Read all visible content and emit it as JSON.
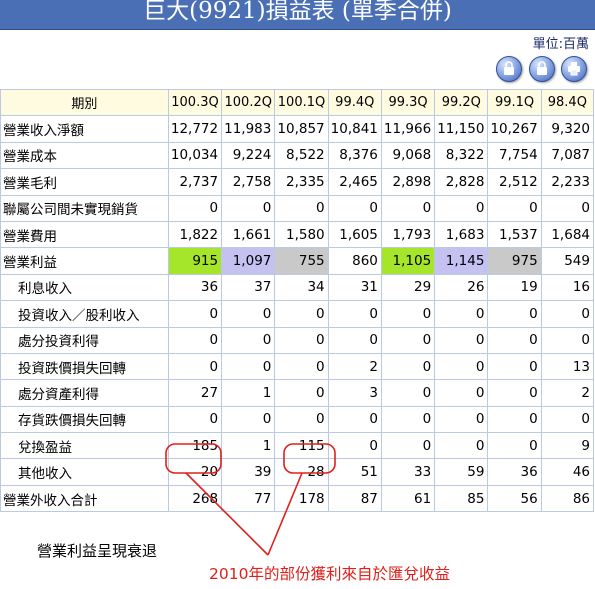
{
  "header": {
    "title": "巨大(9921)損益表 (單季合併)",
    "unit": "單位:百萬"
  },
  "toolbar": {
    "buttons": [
      {
        "icon": "lock-icon"
      },
      {
        "icon": "lock-icon"
      },
      {
        "icon": "printer-icon"
      }
    ]
  },
  "table": {
    "period_header": "期別",
    "periods": [
      "100.3Q",
      "100.2Q",
      "100.1Q",
      "99.4Q",
      "99.3Q",
      "99.2Q",
      "99.1Q",
      "98.4Q"
    ],
    "rows": [
      {
        "label": "營業收入淨額",
        "indent": false,
        "values": [
          "12,772",
          "11,983",
          "10,857",
          "10,841",
          "11,966",
          "11,150",
          "10,267",
          "9,320"
        ]
      },
      {
        "label": "營業成本",
        "indent": false,
        "values": [
          "10,034",
          "9,224",
          "8,522",
          "8,376",
          "9,068",
          "8,322",
          "7,754",
          "7,087"
        ]
      },
      {
        "label": "營業毛利",
        "indent": false,
        "values": [
          "2,737",
          "2,758",
          "2,335",
          "2,465",
          "2,898",
          "2,828",
          "2,512",
          "2,233"
        ]
      },
      {
        "label": "聯屬公司間未實現銷貨",
        "indent": false,
        "values": [
          "0",
          "0",
          "0",
          "0",
          "0",
          "0",
          "0",
          "0"
        ]
      },
      {
        "label": "營業費用",
        "indent": false,
        "values": [
          "1,822",
          "1,661",
          "1,580",
          "1,605",
          "1,793",
          "1,683",
          "1,537",
          "1,684"
        ]
      },
      {
        "label": "營業利益",
        "indent": false,
        "values": [
          "915",
          "1,097",
          "755",
          "860",
          "1,105",
          "1,145",
          "975",
          "549"
        ],
        "highlights": [
          "green",
          "purple",
          "gray",
          "",
          "green",
          "purple",
          "gray",
          ""
        ]
      },
      {
        "label": "利息收入",
        "indent": true,
        "values": [
          "36",
          "37",
          "34",
          "31",
          "29",
          "26",
          "19",
          "16"
        ]
      },
      {
        "label": "投資收入／股利收入",
        "indent": true,
        "values": [
          "0",
          "0",
          "0",
          "0",
          "0",
          "0",
          "0",
          "0"
        ]
      },
      {
        "label": "處分投資利得",
        "indent": true,
        "values": [
          "0",
          "0",
          "0",
          "0",
          "0",
          "0",
          "0",
          "0"
        ]
      },
      {
        "label": "投資跌價損失回轉",
        "indent": true,
        "values": [
          "0",
          "0",
          "0",
          "2",
          "0",
          "0",
          "0",
          "13"
        ]
      },
      {
        "label": "處分資產利得",
        "indent": true,
        "values": [
          "27",
          "1",
          "0",
          "3",
          "0",
          "0",
          "0",
          "2"
        ]
      },
      {
        "label": "存貨跌價損失回轉",
        "indent": true,
        "values": [
          "0",
          "0",
          "0",
          "0",
          "0",
          "0",
          "0",
          "0"
        ]
      },
      {
        "label": "兌換盈益",
        "indent": true,
        "values": [
          "185",
          "1",
          "115",
          "0",
          "0",
          "0",
          "0",
          "9"
        ]
      },
      {
        "label": "其他收入",
        "indent": true,
        "values": [
          "20",
          "39",
          "28",
          "51",
          "33",
          "59",
          "36",
          "46"
        ]
      },
      {
        "label": "營業外收入合計",
        "indent": false,
        "values": [
          "268",
          "77",
          "178",
          "87",
          "61",
          "85",
          "56",
          "86"
        ]
      }
    ]
  },
  "annotations": {
    "note_decline": "營業利益呈現衰退",
    "note_fx": "2010年的部份獲利來自於匯兌收益",
    "accent_color": "#e0201a"
  },
  "colors": {
    "title_bg": "#4a6fb5",
    "header_bg": "#fffbe0",
    "highlight_green": "#a6e62a",
    "highlight_purple": "#c5c2f2",
    "highlight_gray": "#c9c9c9"
  }
}
